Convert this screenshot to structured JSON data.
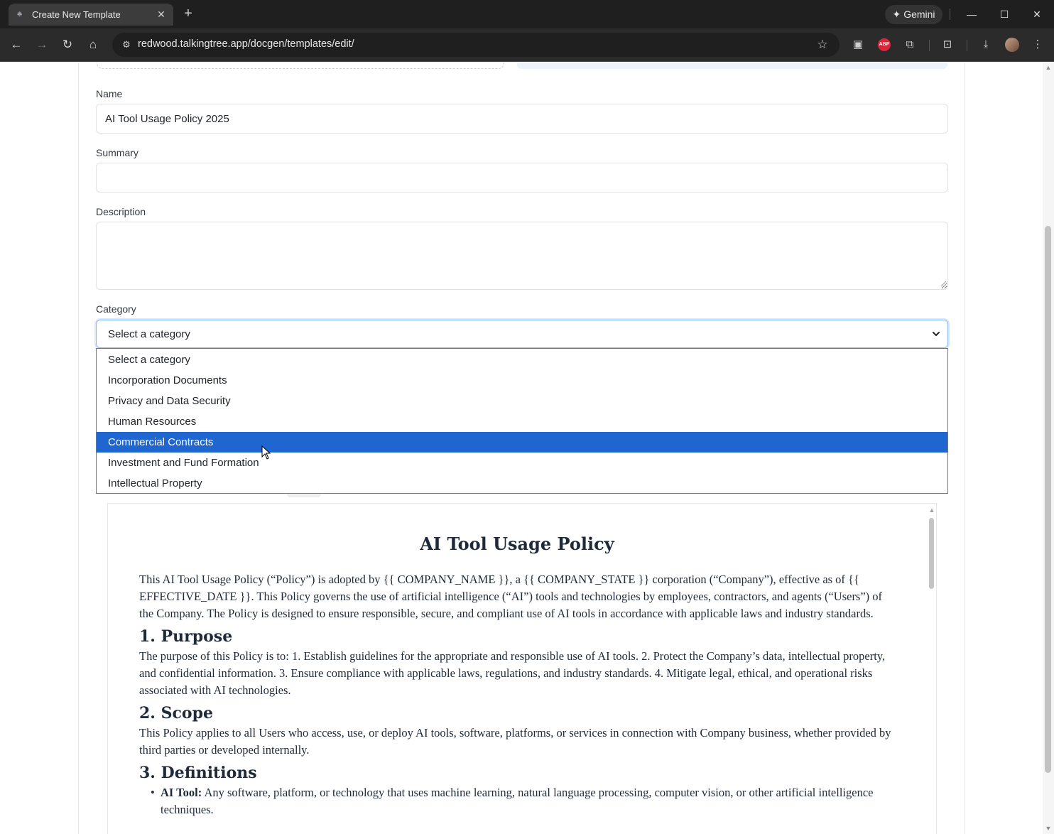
{
  "browser": {
    "tab_title": "Create New Template",
    "url": "redwood.talkingtree.app/docgen/templates/edit/",
    "gemini_label": "Gemini",
    "abp_label": "ABP"
  },
  "form": {
    "name_label": "Name",
    "name_value": "AI Tool Usage Policy 2025",
    "summary_label": "Summary",
    "summary_value": "",
    "description_label": "Description",
    "description_value": "",
    "category_label": "Category",
    "category_selected": "Select a category",
    "category_options": [
      "Select a category",
      "Incorporation Documents",
      "Privacy and Data Security",
      "Human Resources",
      "Commercial Contracts",
      "Investment and Fund Formation",
      "Intellectual Property"
    ],
    "highlighted_option_index": 4
  },
  "preview": {
    "title": "AI Tool Usage Policy",
    "intro": "This AI Tool Usage Policy (“Policy”) is adopted by {{ COMPANY_NAME }}, a {{ COMPANY_STATE }} corporation (“Company”), effective as of {{ EFFECTIVE_DATE }}. This Policy governs the use of artificial intelligence (“AI”) tools and technologies by employees, contractors, and agents (“Users”) of the Company. The Policy is designed to ensure responsible, secure, and compliant use of AI tools in accordance with applicable laws and industry standards.",
    "sections": [
      {
        "heading": "1. Purpose",
        "body": "The purpose of this Policy is to: 1. Establish guidelines for the appropriate and responsible use of AI tools. 2. Protect the Company’s data, intellectual property, and confidential information. 3. Ensure compliance with applicable laws, regulations, and industry standards. 4. Mitigate legal, ethical, and operational risks associated with AI technologies."
      },
      {
        "heading": "2. Scope",
        "body": "This Policy applies to all Users who access, use, or deploy AI tools, software, platforms, or services in connection with Company business, whether provided by third parties or developed internally."
      },
      {
        "heading": "3. Definitions",
        "body": ""
      }
    ],
    "definitions": [
      {
        "term": "AI Tool:",
        "text": " Any software, platform, or technology that uses machine learning, natural language processing, computer vision, or other artificial intelligence techniques."
      }
    ]
  },
  "colors": {
    "highlight": "#1f66d1",
    "focus_border": "#86b7fe"
  }
}
